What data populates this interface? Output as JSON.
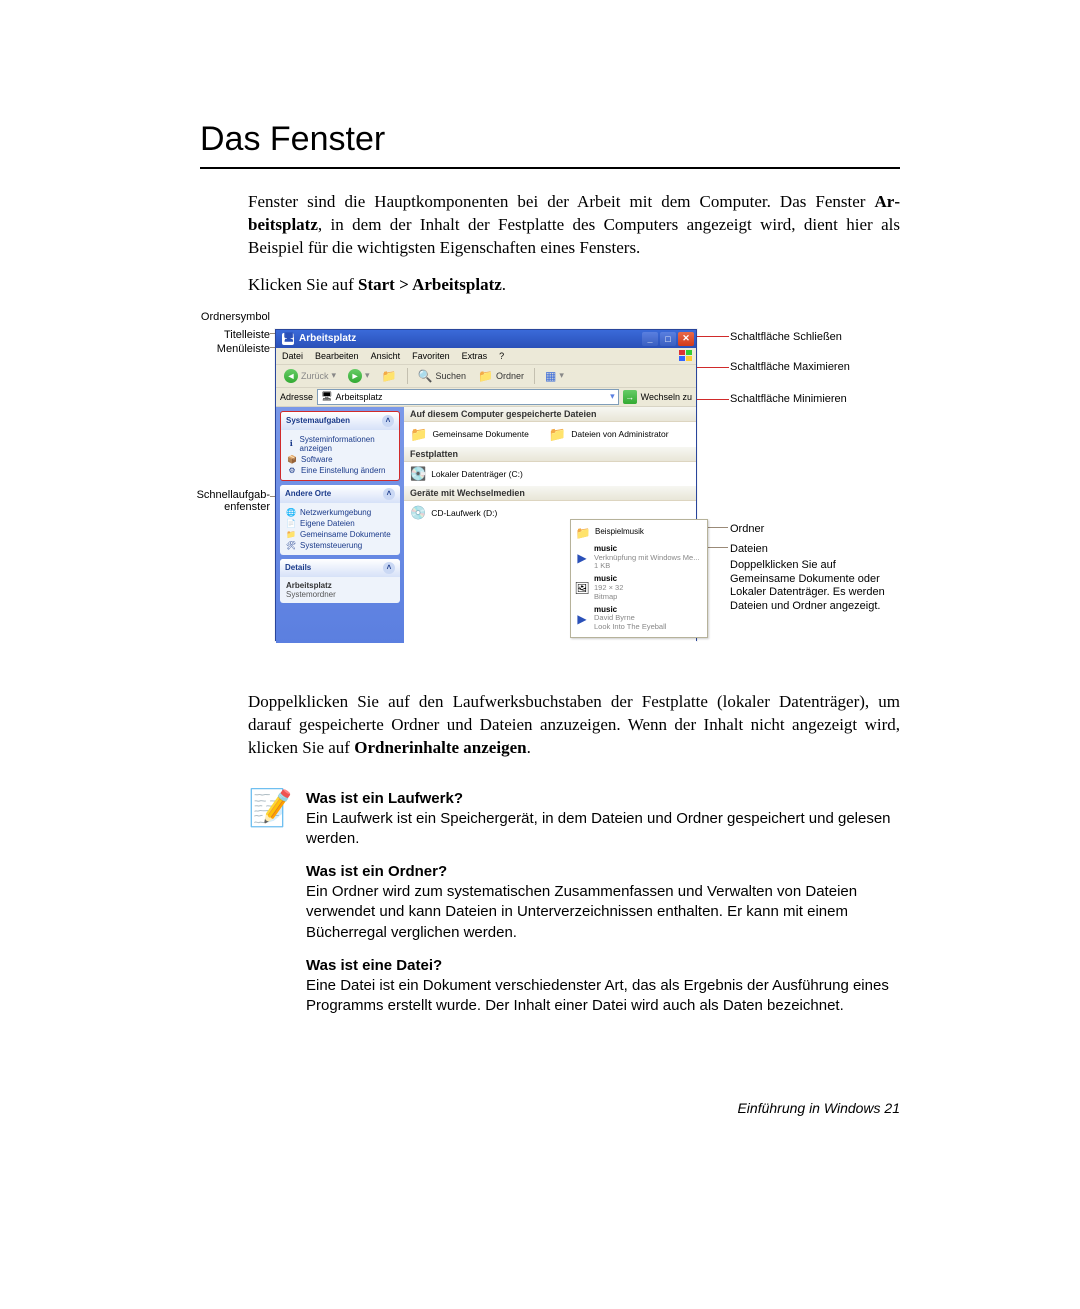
{
  "heading": "Das Fenster",
  "para1_a": "Fenster sind die Hauptkomponenten bei der Arbeit mit dem Computer. Das Fenster ",
  "para1_b": "Ar­beitsplatz",
  "para1_c": ", in dem der Inhalt der Festplatte des Computers angezeigt wird, dient hier als Beispiel für die wichtigsten Eigenschaften eines Fensters.",
  "para2_a": "Klicken Sie auf ",
  "para2_b": "Start > Arbeitsplatz",
  "para2_c": ".",
  "labels": {
    "ordnersymbol": "Ordnersymbol",
    "titelleiste": "Titelleiste",
    "menueleiste": "Menüleiste",
    "schnellaufgaben": "Schnellaufgab­enfenster",
    "btn_close": "Schaltfläche Schließen",
    "btn_max": "Schaltfläche Maximieren",
    "btn_min": "Schaltfläche Minimieren",
    "ordner": "Ordner",
    "dateien": "Dateien",
    "dateien_desc": "Doppelklicken Sie auf Gemeinsame Doku­mente oder Lokaler Dat­enträger. Es werden Dateien und Ordner angezeigt."
  },
  "window": {
    "title": "Arbeitsplatz",
    "menu": [
      "Datei",
      "Bearbeiten",
      "Ansicht",
      "Favoriten",
      "Extras",
      "?"
    ],
    "toolbar": {
      "back": "Zurück",
      "search": "Suchen",
      "folders": "Ordner"
    },
    "address_label": "Adresse",
    "address_value": "Arbeitsplatz",
    "go_label": "Wechseln zu",
    "side": {
      "tasks_head": "Systemaufgaben",
      "tasks": [
        "Systeminformationen anzeigen",
        "Software",
        "Eine Einstellung ändern"
      ],
      "other_head": "Andere Orte",
      "other": [
        "Netzwerkumgebung",
        "Eigene Dateien",
        "Gemeinsame Dokumente",
        "Systemsteuerung"
      ],
      "details_head": "Details",
      "details_title": "Arbeitsplatz",
      "details_sub": "Systemordner"
    },
    "sections": {
      "stored_head": "Auf diesem Computer gespeicherte Dateien",
      "stored_items": [
        "Gemeinsame Dokumente",
        "Dateien von Administrator"
      ],
      "drives_head": "Festplatten",
      "drives_items": [
        "Lokaler Datenträger (C:)"
      ],
      "removable_head": "Geräte mit Wechselmedien",
      "removable_items": [
        "CD-Laufwerk (D:)"
      ]
    },
    "popup": {
      "row1": "Beispielmusik",
      "row2_title": "music",
      "row2_sub": "Verknüpfung mit Windows Me...",
      "row2_size": "1 KB",
      "row3_title": "music",
      "row3_sub": "192 × 32",
      "row3_type": "Bitmap",
      "row4_title": "music",
      "row4_sub": "David Byrne",
      "row4_track": "Look Into The Eyeball"
    }
  },
  "para3_a": "Doppelklicken Sie auf den Laufwerksbuchstaben der Festplatte (lokaler Datenträger), um darauf gespeicherte Ordner und Dateien anzuzeigen. Wenn der Inhalt nicht an­gezeigt wird, klicken Sie auf ",
  "para3_b": "Ordnerinhalte anzeigen",
  "para3_c": ".",
  "info": {
    "q1": "Was ist ein Laufwerk?",
    "a1": "Ein Laufwerk ist ein Speichergerät, in dem Dateien und Ordner gespeichert und gelesen werden.",
    "q2": "Was ist ein Ordner?",
    "a2": "Ein Ordner wird zum systematischen Zusammenfassen und Verwalten von Dateien verwendet und kann Dateien in Unterverzeichnissen enthalten. Er kann mit einem Bücherregal verglichen werden.",
    "q3": "Was ist eine Datei?",
    "a3": "Eine Datei ist ein Dokument verschiedenster Art, das als Ergebnis der Aus­führung eines Programms erstellt wurde. Der Inhalt einer Datei wird auch als Daten bezeichnet."
  },
  "footer_a": "Einführung in Windows",
  "footer_b": "  21"
}
